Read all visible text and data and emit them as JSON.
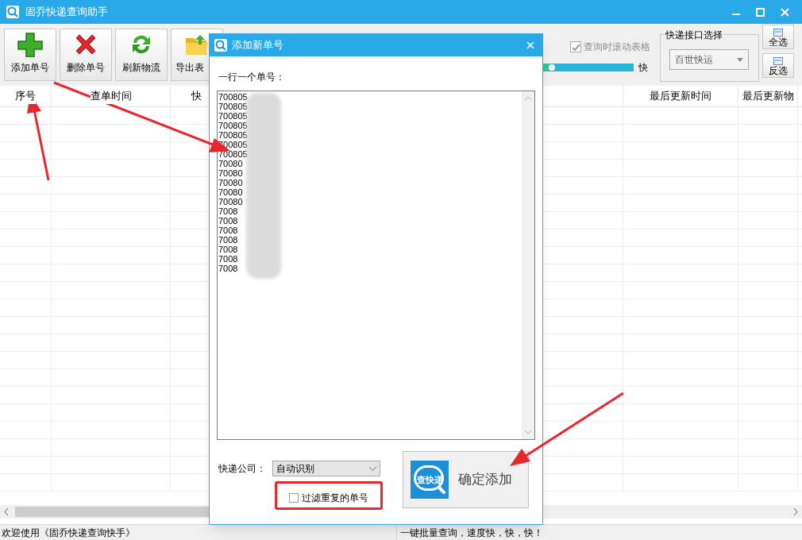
{
  "window": {
    "title": "固乔快递查询助手"
  },
  "toolbar": {
    "buttons": [
      {
        "kind": "add",
        "label": "添加单号"
      },
      {
        "kind": "delete",
        "label": "删除单号"
      },
      {
        "kind": "refresh",
        "label": "刷新物流"
      },
      {
        "kind": "export",
        "label": "导出表"
      }
    ],
    "scroll_checkbox": {
      "label": "查询时滚动表格",
      "checked": true,
      "disabled": true
    },
    "speed": {
      "level": 0.1,
      "label": "快"
    },
    "api_group": {
      "title": "快递接口选择",
      "value": "百世快运"
    },
    "select_buttons": [
      "全选",
      "反选"
    ]
  },
  "table": {
    "columns": [
      "序号",
      "查单时间",
      "快",
      "最后更新时间",
      "最后更新物"
    ]
  },
  "status_bar": {
    "left": "欢迎使用《固乔快递查询快手》",
    "right": "一键批量查询，速度快，快，快！"
  },
  "dialog": {
    "title": "添加新单号",
    "prompt": "一行一个单号：",
    "numbers": [
      "700805",
      "700805",
      "700805",
      "700805",
      "700805",
      "700805",
      "700805",
      "70080",
      "70080",
      "70080",
      "70080",
      "70080",
      "7008",
      "7008",
      "7008",
      "7008",
      "7008",
      "7008",
      "7008"
    ],
    "company_label": "快递公司：",
    "company_value": "自动识别",
    "filter_checkbox": {
      "label": "过滤重复的单号",
      "checked": false
    },
    "confirm": {
      "icon_text": "查快递",
      "label": "确定添加"
    }
  }
}
